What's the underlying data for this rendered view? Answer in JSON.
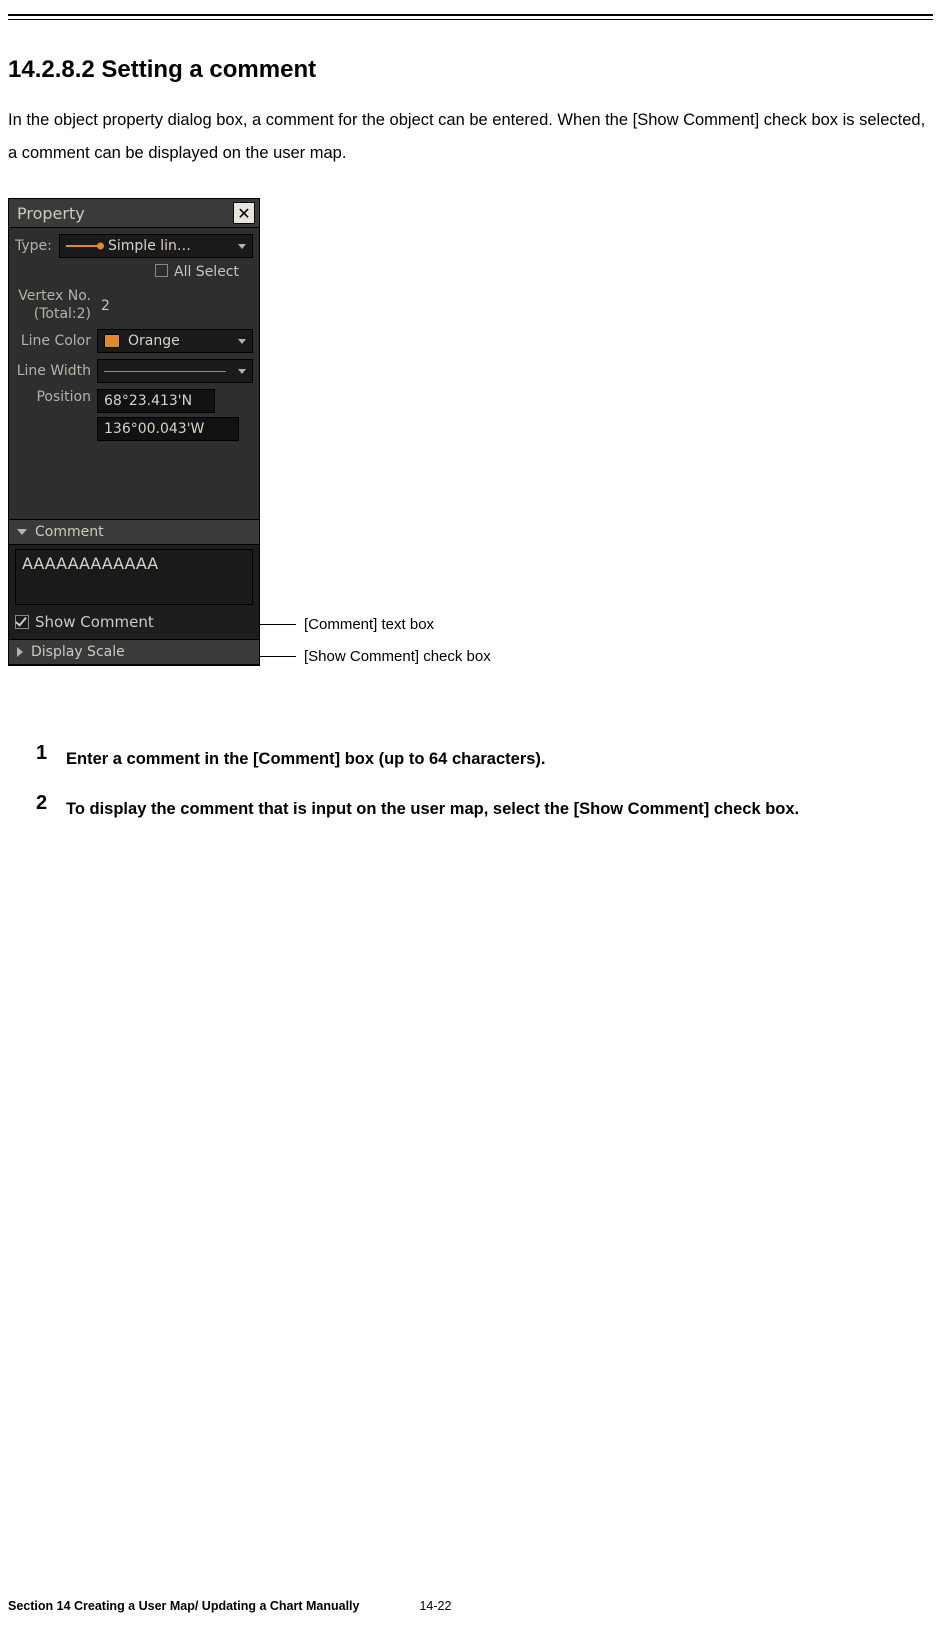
{
  "heading": "14.2.8.2   Setting a comment",
  "intro": "In the object property dialog box, a comment for the object can be entered. When the [Show Comment] check box is selected, a comment can be displayed on the user map.",
  "dialog": {
    "title": "Property",
    "type_label": "Type:",
    "type_value": "Simple lin…",
    "all_select": "All Select",
    "vertex_label_1": "Vertex No.",
    "vertex_label_2": "(Total:2)",
    "vertex_value": "2",
    "line_color_label": "Line Color",
    "line_color_value": "Orange",
    "line_width_label": "Line Width",
    "position_label": "Position",
    "position_lat": "68°23.413'N",
    "position_lon": "136°00.043'W",
    "comment_header": "Comment",
    "comment_value": "AAAAAAAAAAAA",
    "show_comment_label": "Show Comment",
    "display_scale_header": "Display Scale"
  },
  "callouts": {
    "comment_box": "[Comment] text box",
    "show_comment": "[Show Comment] check box"
  },
  "steps": {
    "s1": "Enter a comment in the [Comment] box (up to 64 characters).",
    "s2": "To display the comment that is input on the user map, select the [Show Comment] check box."
  },
  "footer": {
    "section": "Section 14    Creating a User Map/ Updating a Chart Manually",
    "page": "14-22"
  }
}
